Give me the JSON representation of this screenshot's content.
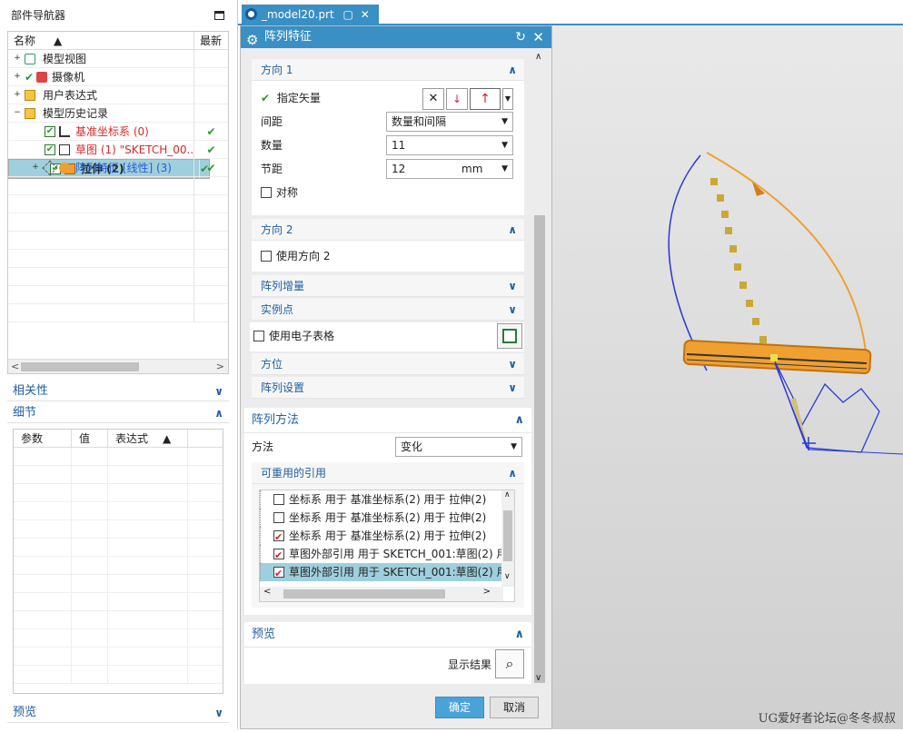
{
  "navigator": {
    "title": "部件导航器",
    "col_name": "名称",
    "col_latest": "最新",
    "items": [
      {
        "label": "模型视图",
        "latest": ""
      },
      {
        "label": "摄像机",
        "latest": ""
      },
      {
        "label": "用户表达式",
        "latest": ""
      },
      {
        "label": "模型历史记录",
        "latest": ""
      },
      {
        "label": "基准坐标系 (0)",
        "latest": "✔"
      },
      {
        "label": "草图 (1) \"SKETCH_00...",
        "latest": "✔"
      },
      {
        "label": "拉伸 (2)",
        "latest": "✔"
      },
      {
        "label": "阵列特征 [线性] (3)",
        "latest": "✔"
      }
    ],
    "dependencies": "相关性",
    "details": "细节",
    "details_cols": [
      "参数",
      "值",
      "表达式"
    ],
    "preview": "预览"
  },
  "tab": {
    "label": "_model20.prt"
  },
  "dialog": {
    "title": "阵列特征",
    "direction1": {
      "header": "方向 1",
      "vector_label": "指定矢量",
      "spacing_label": "间距",
      "spacing_value": "数量和间隔",
      "count_label": "数量",
      "count_value": "11",
      "pitch_label": "节距",
      "pitch_value": "12",
      "pitch_unit": "mm",
      "symmetric_label": "对称"
    },
    "direction2": {
      "header": "方向 2",
      "use_label": "使用方向 2"
    },
    "increment": "阵列增量",
    "instance_points": "实例点",
    "spreadsheet_label": "使用电子表格",
    "orientation": "方位",
    "settings": "阵列设置",
    "method": {
      "header": "阵列方法",
      "method_label": "方法",
      "method_value": "变化",
      "reusable_header": "可重用的引用",
      "references": [
        {
          "text": "坐标系 用于 基准坐标系(2) 用于 拉伸(2)",
          "checked": false
        },
        {
          "text": "坐标系 用于 基准坐标系(2) 用于 拉伸(2)",
          "checked": false
        },
        {
          "text": "坐标系 用于 基准坐标系(2) 用于 拉伸(2)",
          "checked": true
        },
        {
          "text": "草图外部引用 用于 SKETCH_001:草图(2) 用",
          "checked": true
        },
        {
          "text": "草图外部引用 用于 SKETCH_001:草图(2) 用",
          "checked": true
        }
      ]
    },
    "preview": {
      "header": "预览",
      "show_result": "显示结果"
    },
    "ok": "确定",
    "cancel": "取消"
  },
  "watermark": "UG爱好者论坛@冬冬叔叔"
}
